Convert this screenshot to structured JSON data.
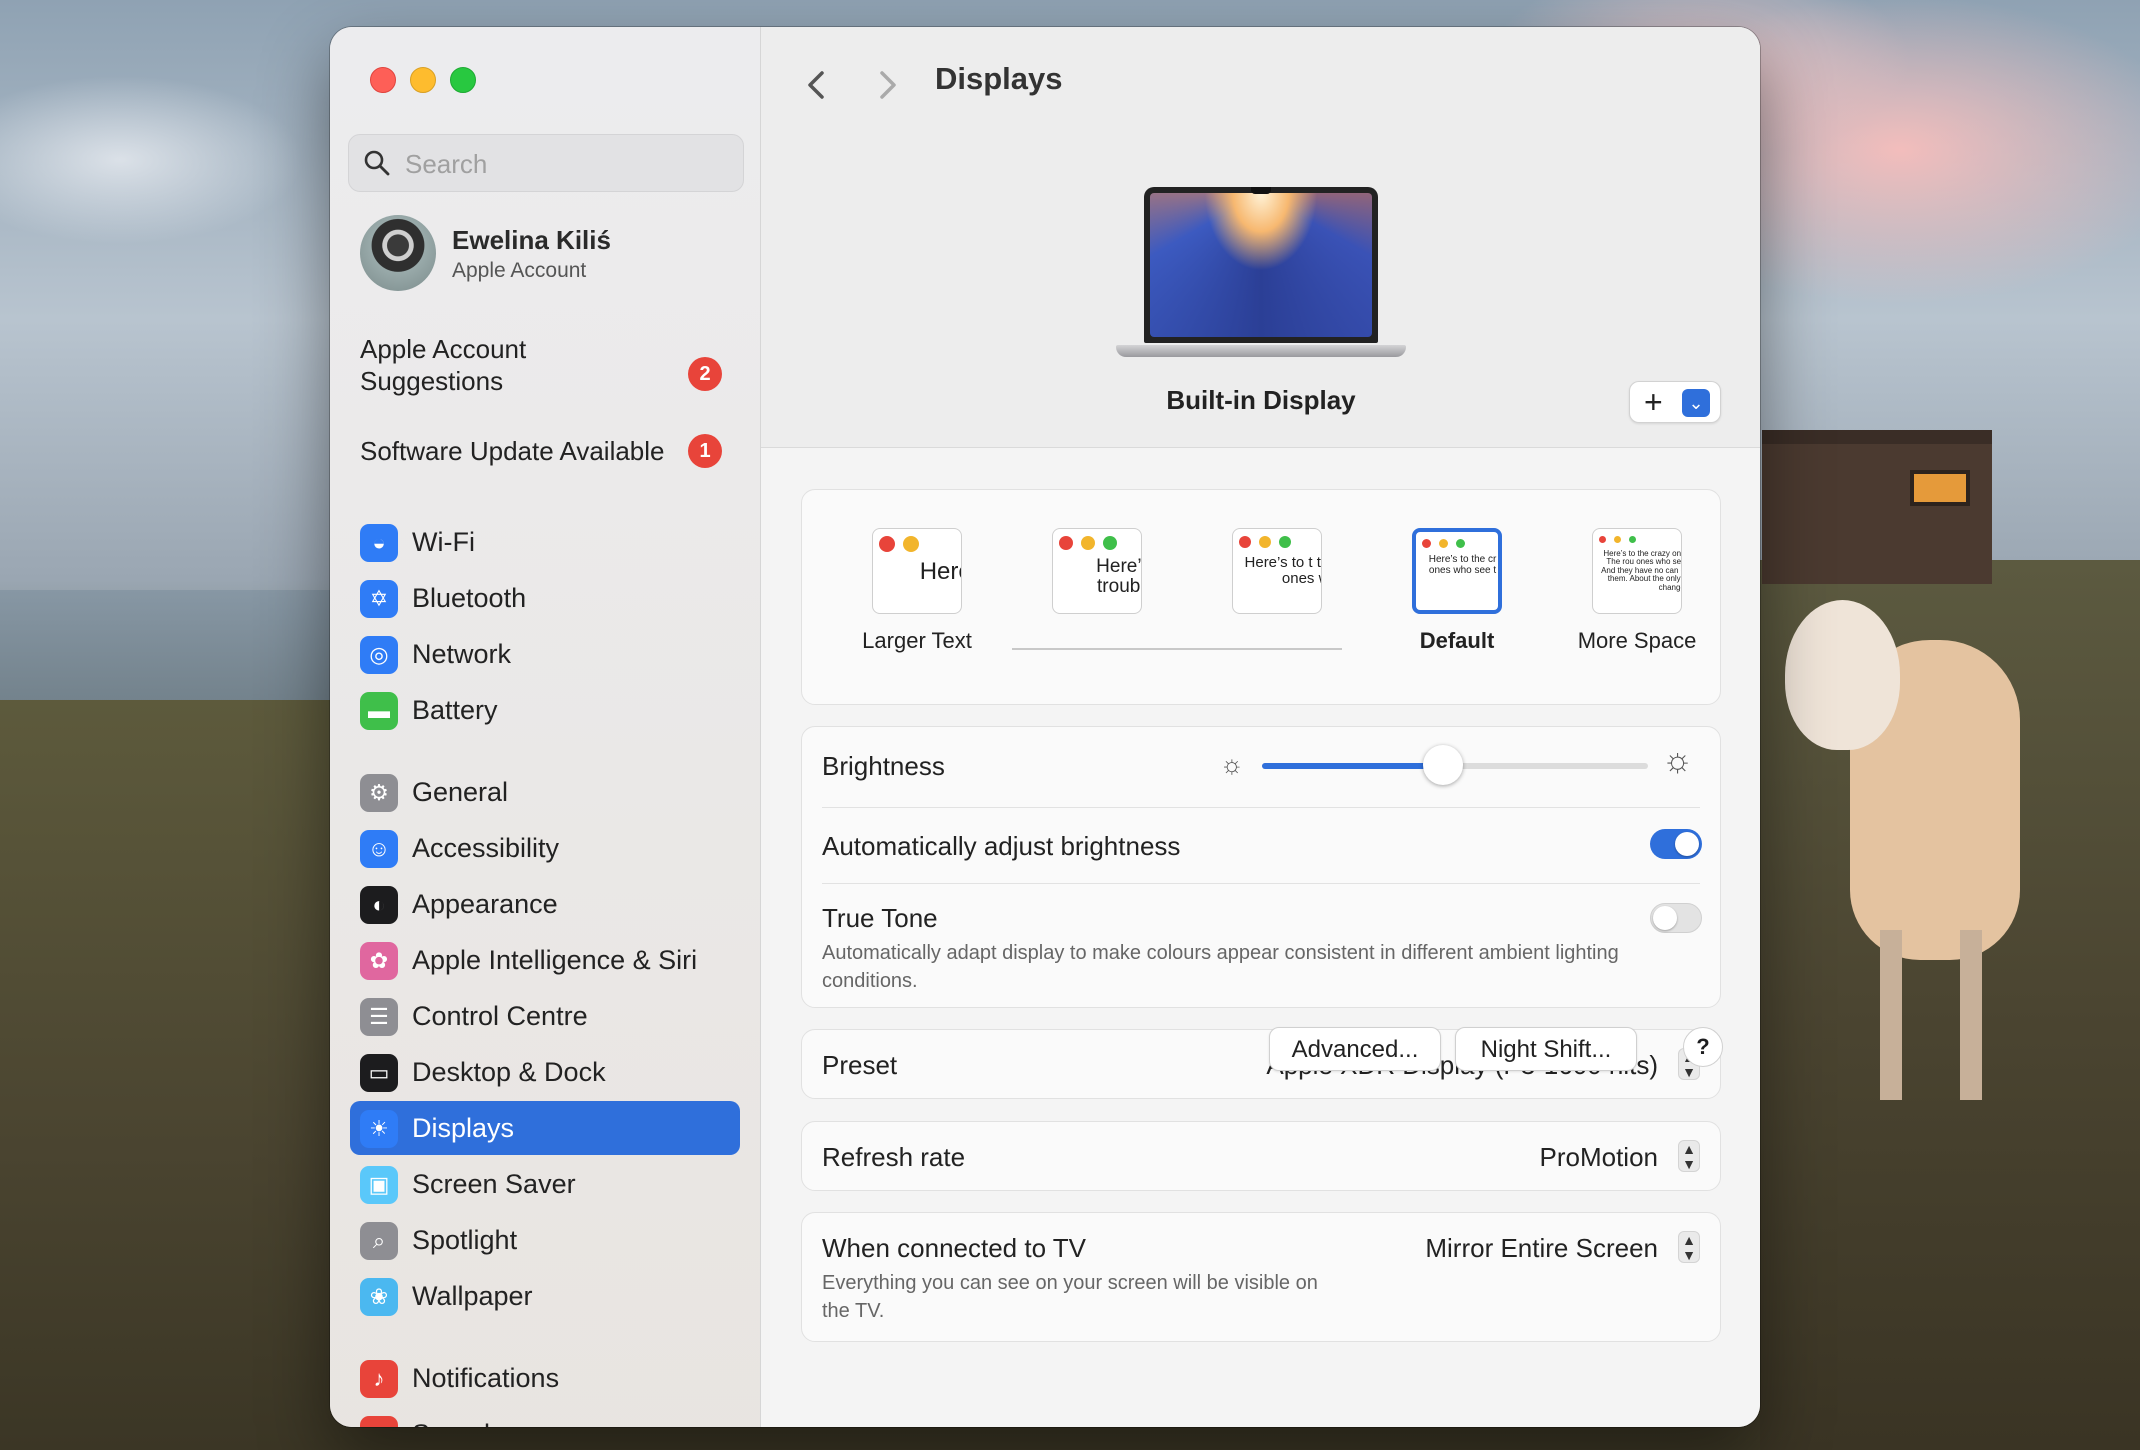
{
  "window": {
    "title": "Displays"
  },
  "search": {
    "placeholder": "Search"
  },
  "profile": {
    "name": "Ewelina Kiliś",
    "subtitle": "Apple Account"
  },
  "suggestions": [
    {
      "label": "Apple Account Suggestions",
      "badge": "2"
    },
    {
      "label": "Software Update Available",
      "badge": "1"
    }
  ],
  "sidebar": {
    "items": [
      {
        "label": "Wi-Fi",
        "icon": "wifi-icon",
        "color": "#2f7cf6"
      },
      {
        "label": "Bluetooth",
        "icon": "bluetooth-icon",
        "color": "#2f7cf6"
      },
      {
        "label": "Network",
        "icon": "globe-icon",
        "color": "#2f7cf6"
      },
      {
        "label": "Battery",
        "icon": "battery-icon",
        "color": "#3fbf4a"
      },
      {
        "label": "General",
        "icon": "gear-icon",
        "color": "#8e8e93"
      },
      {
        "label": "Accessibility",
        "icon": "accessibility-icon",
        "color": "#2f7cf6"
      },
      {
        "label": "Appearance",
        "icon": "appearance-icon",
        "color": "#1c1c1e"
      },
      {
        "label": "Apple Intelligence & Siri",
        "icon": "siri-icon",
        "color": "#e0679f"
      },
      {
        "label": "Control Centre",
        "icon": "control-centre-icon",
        "color": "#8e8e93"
      },
      {
        "label": "Desktop & Dock",
        "icon": "dock-icon",
        "color": "#1c1c1e"
      },
      {
        "label": "Displays",
        "icon": "sun-icon",
        "color": "#2f7cf6"
      },
      {
        "label": "Screen Saver",
        "icon": "screen-saver-icon",
        "color": "#5ac8fa"
      },
      {
        "label": "Spotlight",
        "icon": "magnifier-icon",
        "color": "#8e8e93"
      },
      {
        "label": "Wallpaper",
        "icon": "flower-icon",
        "color": "#4bb8f0"
      },
      {
        "label": "Notifications",
        "icon": "bell-icon",
        "color": "#e8443a"
      },
      {
        "label": "Sound",
        "icon": "speaker-icon",
        "color": "#e8443a"
      }
    ],
    "active": "Displays"
  },
  "display": {
    "name": "Built-in Display"
  },
  "resolution": {
    "options": [
      {
        "label": "Larger Text",
        "preview": "Here's"
      },
      {
        "label": "",
        "preview": "Here’s to troublem"
      },
      {
        "label": "",
        "preview": "Here’s to t troublema ones who"
      },
      {
        "label": "Default",
        "preview": "Here’s to the cr troublemakers. ones who see t rules. And they"
      },
      {
        "label": "More Space",
        "preview": "Here’s to the crazy ones troublemakers. The rou ones who see things dif rules. And they have no can quote them, disagr them. About the only th Because they change t"
      }
    ],
    "selected": "Default"
  },
  "brightness": {
    "label": "Brightness",
    "value": 0.47
  },
  "auto_brightness": {
    "label": "Automatically adjust brightness",
    "on": true
  },
  "true_tone": {
    "label": "True Tone",
    "description": "Automatically adapt display to make colours appear consistent in different ambient lighting conditions.",
    "on": false
  },
  "preset": {
    "label": "Preset",
    "value": "Apple XDR Display (P3-1600 nits)"
  },
  "refresh_rate": {
    "label": "Refresh rate",
    "value": "ProMotion"
  },
  "tv": {
    "label": "When connected to TV",
    "description": "Everything you can see on your screen will be visible on the TV.",
    "value": "Mirror Entire Screen"
  },
  "buttons": {
    "advanced": "Advanced...",
    "night_shift": "Night Shift...",
    "help": "?"
  },
  "colors": {
    "accent": "#2f6fdb"
  }
}
